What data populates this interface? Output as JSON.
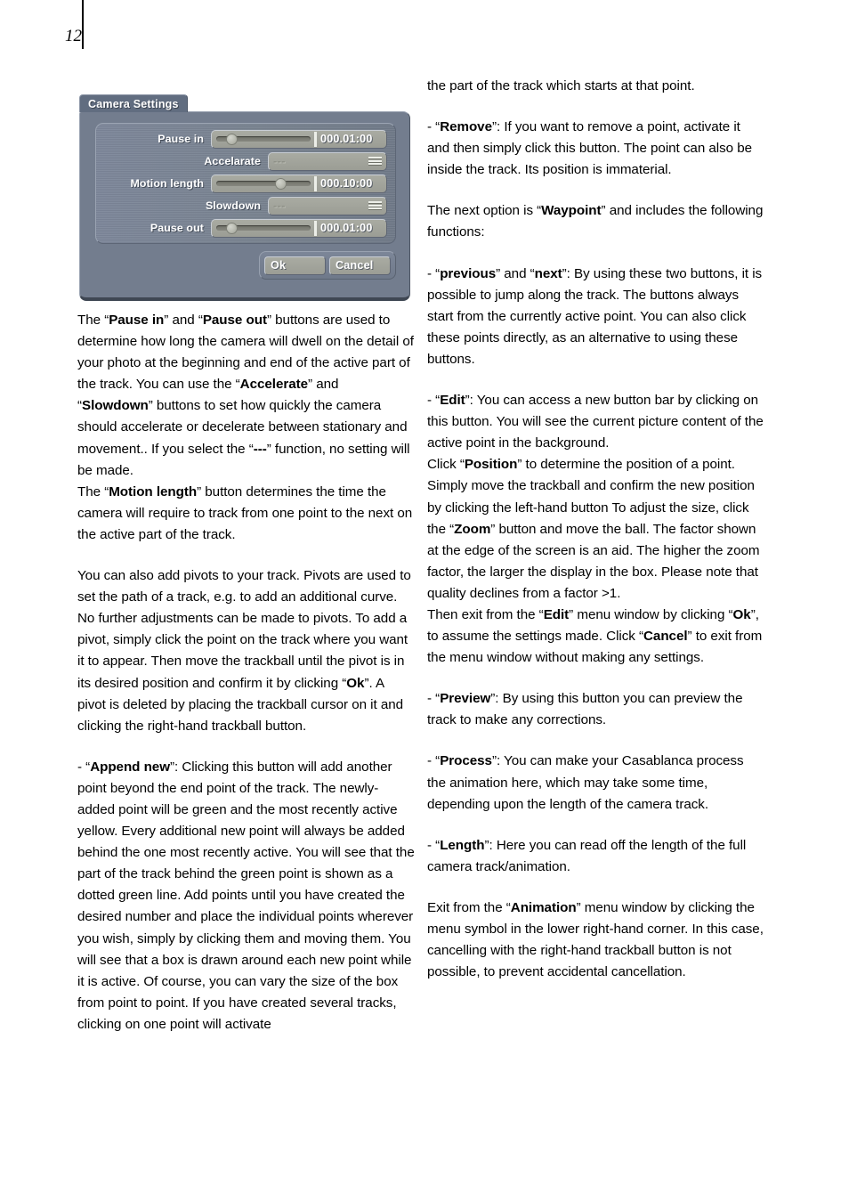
{
  "page": {
    "number": "12"
  },
  "figure": {
    "title": "Camera Settings",
    "rows": [
      {
        "label": "Pause in",
        "type": "slider",
        "value": "000.01:00",
        "knob_pct": 12
      },
      {
        "label": "Accelarate",
        "type": "dropdown",
        "value": "---"
      },
      {
        "label": "Motion length",
        "type": "slider",
        "value": "000.10:00",
        "knob_pct": 62
      },
      {
        "label": "Slowdown",
        "type": "dropdown",
        "value": "---"
      },
      {
        "label": "Pause out",
        "type": "slider",
        "value": "000.01:00",
        "knob_pct": 12
      }
    ],
    "buttons": {
      "ok": "Ok",
      "cancel": "Cancel"
    },
    "colors": {
      "dialog_body": "#737d8e",
      "title_tab": "#616d80",
      "panel": "#78828f",
      "widget": "#a0a299",
      "label_text": "#ffffff"
    }
  },
  "left_column": {
    "p1_a": "The “",
    "p1_b": "Pause in",
    "p1_c": "” and “",
    "p1_d": "Pause out",
    "p1_e": "” buttons are used to determine how long the camera will dwell on the detail of your photo at the beginning and end of the active part of the track. You can use the “",
    "p1_f": "Accelerate",
    "p1_g": "” and “",
    "p1_h": "Slowdown",
    "p1_i": "” buttons to set how quickly the camera should accelerate or decelerate between stationary and movement.. If you select the “",
    "p1_j": "---",
    "p1_k": "” function, no setting will be made.",
    "p2_a": "The “",
    "p2_b": "Motion length",
    "p2_c": "” button determines the time the camera will require to track from one point to the next on the active part of the track.",
    "p3": "You can also add pivots to your track. Pivots are used to set the path of a track, e.g. to add an additional curve. No further adjustments can be made to pivots. To add a pivot, simply click the point on the track where you want it to appear. Then move the trackball until the pivot is in its desired position and confirm it by clicking “",
    "p3_b": "Ok",
    "p3_c": "”. A pivot is deleted by placing the trackball cursor on it and clicking the right-hand trackball button.",
    "p4_a": "- “",
    "p4_b": "Append new",
    "p4_c": "”: Clicking this button will add another point beyond the end point of the track. The newly-added point will be green and the most recently active yellow. Every additional new point will always be added behind the one most recently active. You will see that the part of the track behind the green point is shown as a dotted green line. Add points until you have created the desired number and place the individual points wherever you wish, simply by clicking them and moving them. You will see that a box is drawn around each new point while it is active. Of course, you can vary the size of the box from point to point. If you have created several tracks, clicking on one point will activate"
  },
  "right_column": {
    "p1": "the part of the track which starts at that point.",
    "p2_a": "- “",
    "p2_b": "Remove",
    "p2_c": "”: If you want to remove a point, activate it and then simply click this button. The point can also be inside the track. Its position is immaterial.",
    "p3_a": "The next option is “",
    "p3_b": "Waypoint",
    "p3_c": "” and includes the following functions:",
    "p4_a": "- “",
    "p4_b": "previous",
    "p4_c": "” and “",
    "p4_d": "next",
    "p4_e": "”: By using these two buttons, it is possible to jump along the track. The buttons always start from the currently active point. You can also click these points directly, as an alternative to using these buttons.",
    "p5_a": "- “",
    "p5_b": "Edit",
    "p5_c": "”: You can access a new button bar by clicking on this button. You will see the current picture content of the active point in the background.",
    "p6_a": "Click “",
    "p6_b": "Position",
    "p6_c": "” to determine the position of a point. Simply move the trackball and confirm the new position by clicking the left-hand button To adjust the size, click the “",
    "p6_d": "Zoom",
    "p6_e": "” button and move the ball. The factor shown at the edge of the screen is an aid. The higher the zoom factor, the larger the display in the box. Please note that quality declines from a factor >1.",
    "p7_a": "Then exit from the “",
    "p7_b": "Edit",
    "p7_c": "” menu window by clicking “",
    "p7_d": "Ok",
    "p7_e": "”, to assume the settings made. Click “",
    "p7_f": "Cancel",
    "p7_g": "” to exit from the menu window without making any settings.",
    "p8_a": "- “",
    "p8_b": "Preview",
    "p8_c": "”: By using this button you can preview the track to make any corrections.",
    "p9_a": "- “",
    "p9_b": "Process",
    "p9_c": "”: You can make your Casablanca process the animation here, which may take some time, depending upon the length of the camera track.",
    "p10_a": "- “",
    "p10_b": "Length",
    "p10_c": "”: Here you can read off the length of the full camera track/animation.",
    "p11_a": "Exit from the “",
    "p11_b": "Animation",
    "p11_c": "” menu window by clicking the menu symbol in the lower right-hand corner. In this case, cancelling with the right-hand trackball button is not possible, to prevent accidental cancellation."
  }
}
